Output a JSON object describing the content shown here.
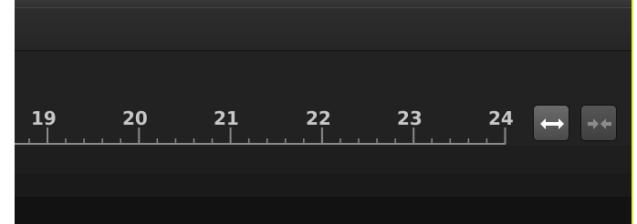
{
  "timeline": {
    "ruler_labels": [
      "19",
      "20",
      "21",
      "22",
      "23",
      "24"
    ],
    "minor_ticks_per_unit": 5
  },
  "toolbar": {
    "expand_icon": "expand-arrows-icon",
    "collapse_icon": "collapse-arrows-icon"
  },
  "colors": {
    "panel_background": "#1b1b1b",
    "ruler_text": "#c8c8c8",
    "ruler_line": "#8a8a8a",
    "right_border": "#e8e83a",
    "expand_arrow": "#ffffff",
    "collapse_arrow": "#8c8c8c"
  }
}
